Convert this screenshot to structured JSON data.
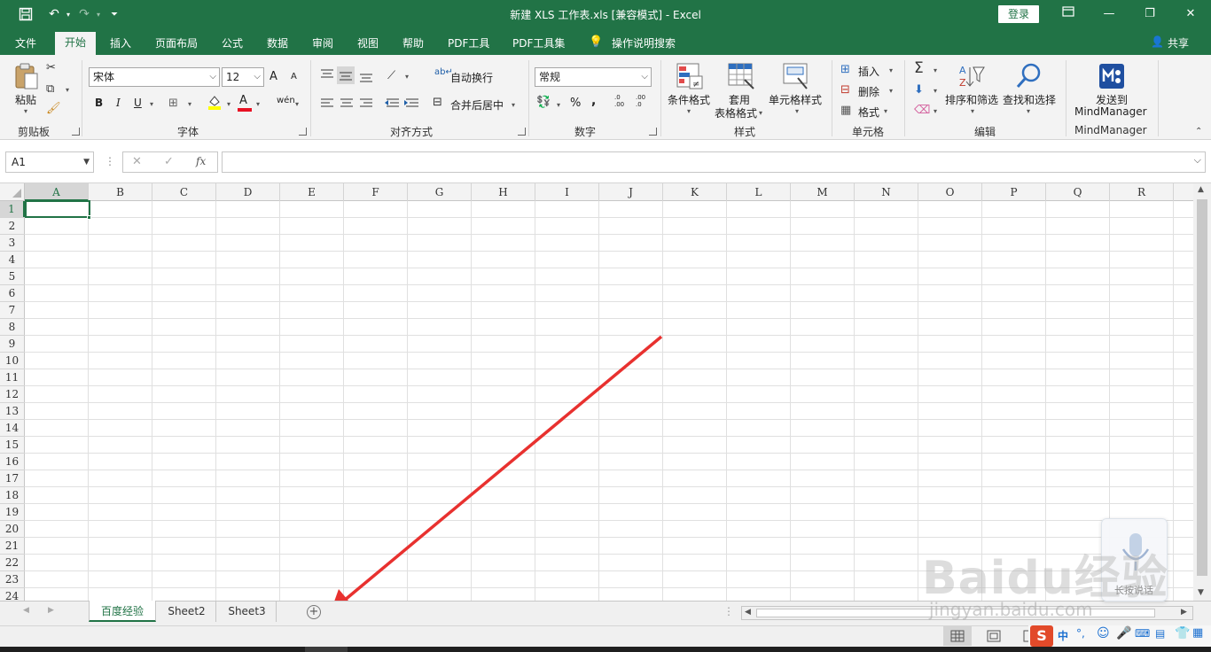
{
  "window": {
    "title": "新建 XLS 工作表.xls  [兼容模式]  -  Excel",
    "login_label": "登录",
    "share_label": "共享",
    "colors": {
      "accent": "#217346",
      "ribbon_bg": "#f3f3f3",
      "arrow": "#e8312f"
    }
  },
  "tabs": [
    {
      "label": "文件"
    },
    {
      "label": "开始"
    },
    {
      "label": "插入"
    },
    {
      "label": "页面布局"
    },
    {
      "label": "公式"
    },
    {
      "label": "数据"
    },
    {
      "label": "审阅"
    },
    {
      "label": "视图"
    },
    {
      "label": "帮助"
    },
    {
      "label": "PDF工具"
    },
    {
      "label": "PDF工具集"
    },
    {
      "label": "操作说明搜索"
    }
  ],
  "ribbon": {
    "clipboard": {
      "paste_label": "粘贴",
      "group_label": "剪贴板"
    },
    "font": {
      "font_name": "宋体",
      "font_size": "12",
      "bold": "B",
      "italic": "I",
      "underline": "U",
      "grow": "A",
      "shrink": "A",
      "fill_letter": "A",
      "phonetic": "wén",
      "group_label": "字体"
    },
    "alignment": {
      "wrap_label": "自动换行",
      "merge_label": "合并后居中",
      "group_label": "对齐方式"
    },
    "number": {
      "format": "常规",
      "percent": "%",
      "comma": ",",
      "inc_dec": ".0\n.00",
      "dec_dec": ".00\n.0",
      "group_label": "数字"
    },
    "styles": {
      "cond_format_label": "条件格式",
      "table_format_label_1": "套用",
      "table_format_label_2": "表格格式",
      "cell_styles_label": "单元格样式",
      "group_label": "样式"
    },
    "cells": {
      "insert_label": "插入",
      "delete_label": "删除",
      "format_label": "格式",
      "group_label": "单元格"
    },
    "editing": {
      "sort_filter_label": "排序和筛选",
      "find_select_label": "查找和选择",
      "group_label": "编辑"
    },
    "mindmanager": {
      "send_label_1": "发送到",
      "send_label_2": "MindManager",
      "group_label": "MindManager"
    }
  },
  "formula_bar": {
    "name_box": "A1",
    "fx": "fx",
    "cancel": "✕",
    "enter": "✓",
    "value": ""
  },
  "grid": {
    "columns": [
      "A",
      "B",
      "C",
      "D",
      "E",
      "F",
      "G",
      "H",
      "I",
      "J",
      "K",
      "L",
      "M",
      "N",
      "O",
      "P",
      "Q",
      "R"
    ],
    "rows": [
      "1",
      "2",
      "3",
      "4",
      "5",
      "6",
      "7",
      "8",
      "9",
      "10",
      "11",
      "12",
      "13",
      "14",
      "15",
      "16",
      "17",
      "18",
      "19",
      "20",
      "21",
      "22",
      "23",
      "24"
    ],
    "active_cell": "A1"
  },
  "sheets": [
    {
      "label": "百度经验",
      "active": true
    },
    {
      "label": "Sheet2"
    },
    {
      "label": "Sheet3"
    }
  ],
  "watermark": {
    "brand": "Baidu经验",
    "url": "jingyan.baidu.com",
    "voice_label": "长按说话"
  }
}
